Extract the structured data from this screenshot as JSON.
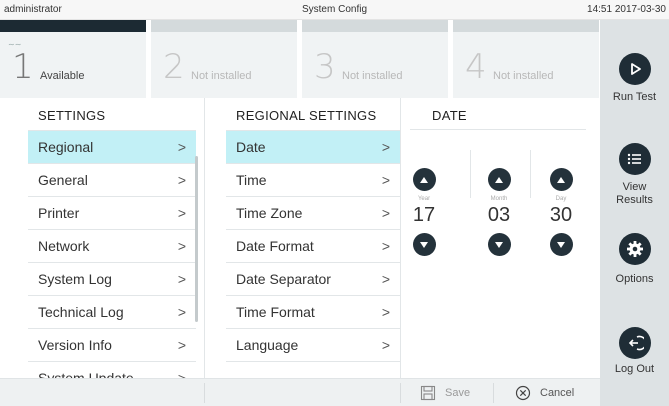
{
  "topbar": {
    "user": "administrator",
    "title": "System Config",
    "clock": "14:51 2017-03-30"
  },
  "modules": [
    {
      "number": "1",
      "status": "Available",
      "active": true
    },
    {
      "number": "2",
      "status": "Not installed",
      "active": false
    },
    {
      "number": "3",
      "status": "Not installed",
      "active": false
    },
    {
      "number": "4",
      "status": "Not installed",
      "active": false
    }
  ],
  "sidebar": {
    "run_test": "Run Test",
    "view_results": "View Results",
    "options": "Options",
    "log_out": "Log Out"
  },
  "settings": {
    "heading": "SETTINGS",
    "items": [
      "Regional",
      "General",
      "Printer",
      "Network",
      "System Log",
      "Technical Log",
      "Version Info",
      "System Update"
    ],
    "selected": "Regional"
  },
  "regional": {
    "heading": "REGIONAL SETTINGS",
    "items": [
      "Date",
      "Time",
      "Time Zone",
      "Date Format",
      "Date Separator",
      "Time Format",
      "Language"
    ],
    "selected": "Date"
  },
  "date": {
    "heading": "DATE",
    "year_caption": "Year",
    "year": "17",
    "month_caption": "Month",
    "month": "03",
    "day_caption": "Day",
    "day": "30"
  },
  "bottom": {
    "save": "Save",
    "cancel": "Cancel"
  },
  "colors": {
    "accent": "#c2f0f6",
    "dark_button": "#1f2d36",
    "sidebar_bg": "#dde2e4"
  }
}
